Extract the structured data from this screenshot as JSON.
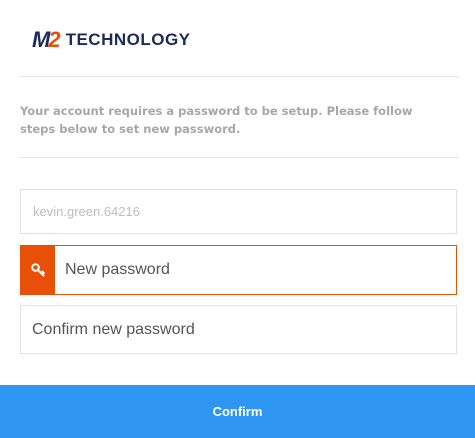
{
  "brand": {
    "mark_m": "M",
    "mark_2": "2",
    "name": "TECHNOLOGY",
    "colors": {
      "navy": "#1f2a5c",
      "orange": "#e8500a"
    }
  },
  "instructions": "Your account requires a password to be setup. Please follow steps below to set new password.",
  "form": {
    "username_value": "kevin.green.64216",
    "new_password_placeholder": "New password",
    "confirm_password_placeholder": "Confirm new password",
    "key_icon": "key-icon"
  },
  "actions": {
    "confirm_label": "Confirm",
    "accent_color": "#2f97f3"
  }
}
